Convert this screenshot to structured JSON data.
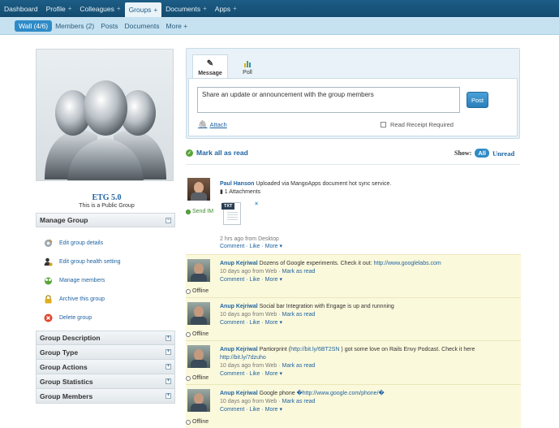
{
  "topnav": {
    "items": [
      {
        "label": "Dashboard",
        "plus": ""
      },
      {
        "label": "Profile",
        "plus": "+"
      },
      {
        "label": "Colleagues",
        "plus": "+"
      },
      {
        "label": "Groups",
        "plus": "+"
      },
      {
        "label": "Documents",
        "plus": "+"
      },
      {
        "label": "Apps",
        "plus": "+"
      }
    ],
    "active_index": 3
  },
  "subnav": {
    "items": [
      "Wall (4/6)",
      "Members (2)",
      "Posts",
      "Documents",
      "More +"
    ],
    "active_index": 0
  },
  "group": {
    "name": "ETG 5.0",
    "subtitle": "This is a Public Group"
  },
  "manage": {
    "title": "Manage Group",
    "toggle": "−",
    "items": [
      {
        "label": "Edit group details",
        "icon": "gear-icon"
      },
      {
        "label": "Edit group health setting",
        "icon": "user-settings-icon"
      },
      {
        "label": "Manage members",
        "icon": "members-icon"
      },
      {
        "label": "Archive this group",
        "icon": "lock-icon"
      },
      {
        "label": "Delete group",
        "icon": "delete-icon"
      }
    ]
  },
  "sections": [
    {
      "label": "Group Description",
      "toggle": "+"
    },
    {
      "label": "Group Type",
      "toggle": "+"
    },
    {
      "label": "Group Actions",
      "toggle": "+"
    },
    {
      "label": "Group Statistics",
      "toggle": "+"
    },
    {
      "label": "Group Members",
      "toggle": "+"
    }
  ],
  "composer": {
    "tabs": [
      {
        "label": "Message",
        "icon": "message-icon"
      },
      {
        "label": "Poll",
        "icon": "poll-icon"
      }
    ],
    "placeholder": "Share an update or announcement with the group members",
    "post_label": "Post",
    "attach_label": "Attach",
    "receipt_label": "Read Receipt Required"
  },
  "feedbar": {
    "mark_all": "Mark all as read",
    "show_label": "Show:",
    "filter_all": "All",
    "filter_unread": "Unread"
  },
  "posts": [
    {
      "author": "Paul Hanson",
      "text": " Uploaded via MangoApps document hot sync service.",
      "attachments": "1 Attachments",
      "file_type": "TXT",
      "file_close": "×",
      "presence": "Send IM",
      "meta": "2 hrs ago from Desktop",
      "actions": "Comment · Like · More ▾"
    },
    {
      "author": "Anup Kejriwal",
      "text_before": " Dozens of Google experiments. Check it out: ",
      "link": "http://www.googlelabs.com",
      "text_after": "",
      "meta": "10 days ago from Web",
      "mark": "Mark as read",
      "actions": "Comment · Like · More ▾",
      "presence": "Offline"
    },
    {
      "author": "Anup Kejriwal",
      "text_before": " Social bar Integration with Engage is up and runnning",
      "link": "",
      "text_after": "",
      "meta": "10 days ago from Web",
      "mark": "Mark as read",
      "actions": "Comment · Like · More ▾",
      "presence": "Offline"
    },
    {
      "author": "Anup Kejriwal",
      "text_before": " Partiorprint (",
      "link": "http://bit.ly/6BT2SN",
      "text_after": " ) got some love on Rails Envy Podcast. Check it here ",
      "link2": "http://bit.ly/7dzuho",
      "meta": "10 days ago from Web",
      "mark": "Mark as read",
      "actions": "Comment · Like · More ▾",
      "presence": "Offline"
    },
    {
      "author": "Anup Kejriwal",
      "text_before": " Google phone ",
      "link": "�http://www.google.com/phone/�",
      "text_after": "",
      "meta": "10 days ago from Web",
      "mark": "Mark as read",
      "actions": "Comment · Like · More ▾",
      "presence": "Offline"
    }
  ],
  "colors": {
    "nav": "#1d5d86",
    "subnav": "#c6e2f1",
    "accent": "#2f8bc7",
    "link": "#1f63a0",
    "unread_bg": "#fbf9dc"
  }
}
